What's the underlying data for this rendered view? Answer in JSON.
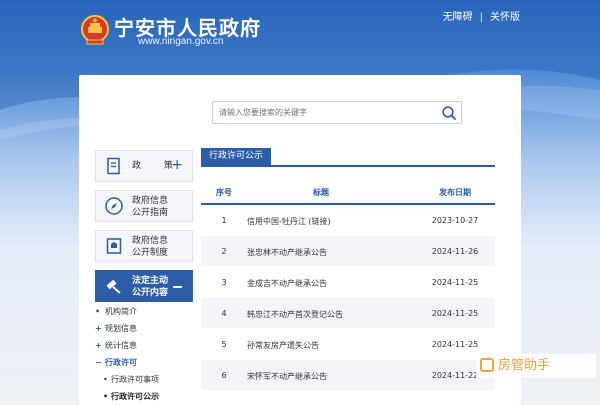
{
  "header": {
    "site_title": "宁安市人民政府",
    "site_url": "www.ningan.gov.cn",
    "links": [
      "无障碍",
      "关怀版"
    ]
  },
  "search": {
    "placeholder": "请输入您要搜索的关键字",
    "value": ""
  },
  "sidebar": {
    "boxes": [
      {
        "label": "政 策",
        "icon": "document-icon",
        "expand": "+"
      },
      {
        "label_line1": "政府信息",
        "label_line2": "公开指南",
        "icon": "compass-icon"
      },
      {
        "label_line1": "政府信息",
        "label_line2": "公开制度",
        "icon": "rules-icon"
      },
      {
        "label_line1": "法定主动",
        "label_line2": "公开内容",
        "icon": "gavel-icon",
        "active": true
      }
    ],
    "subnav": [
      {
        "marker": "•",
        "label": "机构简介"
      },
      {
        "marker": "+",
        "label": "规划信息"
      },
      {
        "marker": "+",
        "label": "统计信息"
      },
      {
        "marker": "−",
        "label": "行政许可"
      }
    ],
    "children": [
      {
        "label": "行政许可事项"
      },
      {
        "label": "行政许可公示"
      }
    ]
  },
  "content": {
    "section_title": "行政许可公示",
    "columns": [
      "序号",
      "标题",
      "发布日期"
    ],
    "rows": [
      {
        "no": "1",
        "title": "信用中国-牡丹江 (链接)",
        "date": "2023-10-27"
      },
      {
        "no": "2",
        "title": "张忠林不动产继承公告",
        "date": "2024-11-26"
      },
      {
        "no": "3",
        "title": "金成吉不动产继承公告",
        "date": "2024-11-25"
      },
      {
        "no": "4",
        "title": "韩忠江不动产首次登记公告",
        "date": "2024-11-25"
      },
      {
        "no": "5",
        "title": "孙常友房产遗失公告",
        "date": "2024-11-25"
      },
      {
        "no": "6",
        "title": "宋怀军不动产继承公告",
        "date": "2024-11-22"
      }
    ]
  },
  "watermark": {
    "text": "房管助手"
  },
  "colors": {
    "accent": "#2b5da8",
    "header_blue": "#2d6cc4",
    "row_alt": "#f3f5f9",
    "watermark": "#e7a73a"
  }
}
